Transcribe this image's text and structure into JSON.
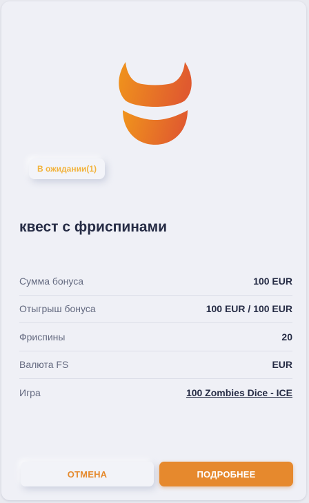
{
  "logo": {
    "icon": "devil-horns-icon",
    "gradient": [
      "#f0941c",
      "#e05a2f"
    ]
  },
  "status_badge": {
    "label": "В ожидании(1)",
    "color": "#f2b33c"
  },
  "bonus": {
    "title": "квест с фриспинами",
    "details": [
      {
        "label": "Сумма бонуса",
        "value": "100 EUR"
      },
      {
        "label": "Отыгрыш бонуса",
        "value": "100 EUR / 100 EUR"
      },
      {
        "label": "Фриспины",
        "value": "20"
      },
      {
        "label": "Валюта FS",
        "value": "EUR"
      },
      {
        "label": "Игра",
        "value": "100 Zombies Dice - ICE"
      }
    ]
  },
  "actions": {
    "cancel_label": "ОТМЕНА",
    "more_label": "ПОДРОБНЕЕ",
    "accent": "#e6892d"
  }
}
